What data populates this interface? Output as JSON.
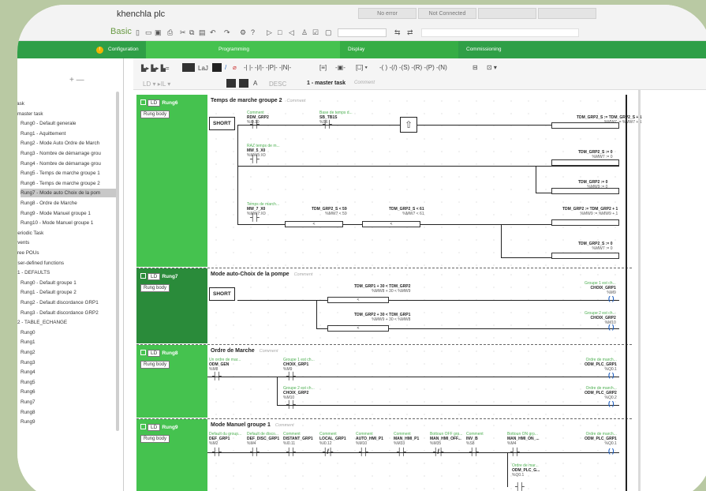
{
  "app": {
    "title": "khenchla plc",
    "mode": "Basic"
  },
  "status": {
    "error": "No error",
    "connection": "Not Connected"
  },
  "steps": {
    "configuration": "Configuration",
    "programming": "Programming",
    "display": "Display",
    "commissioning": "Commissioning",
    "warn_glyph": "!"
  },
  "tree": {
    "items": [
      "Task",
      "master task",
      "Rung0 - Default generale",
      "Rung1 - Aquittement",
      "Rung2 - Mode Auto Ordre de March",
      "Rung3 - Nombre de démarrage grou",
      "Rung4 - Nombre de démarrage grou",
      "Rung5 - Temps de marche groupe 1",
      "Rung6 - Temps de marche groupe 2",
      "Rung7 - Mode auto Choix de la pom",
      "Rung8 - Ordre de Marche",
      "Rung9 - Mode Manuel groupe 1",
      "Rung10 - Mode Manuel groupe 1",
      "Periodic Task",
      "Events",
      "Free POUs",
      "User-defined functions",
      "1 - DEFAULTS",
      "Rung0 - Default groupe 1",
      "Rung1 - Default groupe 2",
      "Rung2 - Default discordance GRP1",
      "Rung3 - Default discordance GRP2",
      "2 - TABLE_ECHANGE",
      "Rung0",
      "Rung1",
      "Rung2",
      "Rung3",
      "Rung4",
      "Rung5",
      "Rung6",
      "Rung7",
      "Rung8",
      "Rung9"
    ],
    "selected_index": 9
  },
  "editor": {
    "task_name": "1 - master task",
    "task_comment": "Comment"
  },
  "rungs": [
    {
      "tag": "Rung6",
      "ld": "LD",
      "body": "Rung body",
      "title": "Temps de marche groupe 2",
      "comment": "Comment",
      "short": "SHORT",
      "c1": {
        "cmt": "Comment",
        "var": "RDM_GRP2",
        "addr": "%I0.10"
      },
      "c2": {
        "cmt": "Base de temps d...",
        "var": "SB_TB1S",
        "addr": "%S6"
      },
      "c3": {
        "cmt": "RAZ temps de m...",
        "var": "MW_5_X0",
        "addr": "%MW5:X0"
      },
      "c4": {
        "cmt": "Temps de march...",
        "var": "MW_7_X0",
        "addr": "%MW7:X0"
      },
      "op1": {
        "expr": "TDM_GRP2_S < 59",
        "addr": "%MW7 < 59",
        "sym": "<"
      },
      "op2": {
        "expr": "TDM_GRP2_S < 61",
        "addr": "%MW7 < 61",
        "sym": "<"
      },
      "a1": {
        "expr": "TDM_GRP2_S := TDM_GRP2_S + 1",
        "addr": "%MW7 := %MW7 + 1"
      },
      "a2": {
        "expr": "TDM_GRP2_S := 0",
        "addr": "%MW7 := 0"
      },
      "a3": {
        "expr": "TDM_GRP2 := 0",
        "addr": "%MW9 := 0"
      },
      "a4": {
        "expr": "TDM_GRP2 := TDM_GRP2 + 1",
        "addr": "%MW9 := %MW9 + 1"
      },
      "a5": {
        "expr": "TDM_GRP2_S := 0",
        "addr": "%MW7 := 0"
      }
    },
    {
      "tag": "Rung7",
      "ld": "LD",
      "body": "Rung body",
      "title": "Mode auto-Choix de la pompe",
      "comment": "Comment",
      "short": "SHORT",
      "op1": {
        "expr": "TDM_GRP1 + 30 < TDM_GRP2",
        "addr": "%MW8 + 30 < %MW9",
        "sym": "<"
      },
      "op2": {
        "expr": "TDM_GRP2 + 30 < TDM_GRP1",
        "addr": "%MW9 + 30 < %MW8",
        "sym": "<"
      },
      "coil1": {
        "cmt": "Groupe 1 est ch...",
        "var": "CHOIX_GRP1",
        "addr": "%M9"
      },
      "coil2": {
        "cmt": "Groupe 2 est ch...",
        "var": "CHOIX_GRP2",
        "addr": "%M10"
      }
    },
    {
      "tag": "Rung8",
      "ld": "LD",
      "body": "Rung body",
      "title": "Ordre de Marche",
      "comment": "Comment",
      "c1": {
        "cmt": "Un ordre de mar...",
        "var": "ODM_GEN",
        "addr": "%M8"
      },
      "c2": {
        "cmt": "Groupe 1 est ch...",
        "var": "CHOIX_GRP1",
        "addr": "%M9"
      },
      "c3": {
        "cmt": "Groupe 2 est ch...",
        "var": "CHOIX_GRP2",
        "addr": "%M10"
      },
      "coil1": {
        "cmt": "Ordre de march...",
        "var": "ODM_PLC_GRP1",
        "addr": "%Q0.1"
      },
      "coil2": {
        "cmt": "Ordre de march...",
        "var": "ODM_PLC_GRP2",
        "addr": "%Q0.2"
      }
    },
    {
      "tag": "Rung9",
      "ld": "LD",
      "body": "Rung body",
      "title": "Mode Manuel groupe 1",
      "comment": "Comment",
      "contacts": [
        {
          "cmt": "Default du group...",
          "var": "DEF_GRP1",
          "addr": "%M2"
        },
        {
          "cmt": "Default de disco...",
          "var": "DEF_DISC_GRP1",
          "addr": "%M4"
        },
        {
          "cmt": "Comment",
          "var": "DISTANT_GRP1",
          "addr": "%I0.11"
        },
        {
          "cmt": "Comment",
          "var": "LOCAL_GRP1",
          "addr": "%I0.12"
        },
        {
          "cmt": "Comment",
          "var": "AUTO_HMI_P1",
          "addr": "%M10"
        },
        {
          "cmt": "Comment",
          "var": "MAN_HMI_P1",
          "addr": "%M33"
        },
        {
          "cmt": "Bottoun OFF grp...",
          "var": "MAN_HMI_OFF...",
          "addr": "%M35"
        },
        {
          "cmt": "Comment",
          "var": "INV_B",
          "addr": "%S8"
        },
        {
          "cmt": "Bottoun ON grp...",
          "var": "MAN_HMI_ON_...",
          "addr": "%M4"
        }
      ],
      "coil1": {
        "cmt": "Ordre de march...",
        "var": "ODM_PLC_GRP1",
        "addr": "%Q0.1"
      },
      "latch": {
        "cmt": "Ordre de mar...",
        "var": "ODM_PLC_G...",
        "addr": "%Q0.1"
      }
    }
  ]
}
